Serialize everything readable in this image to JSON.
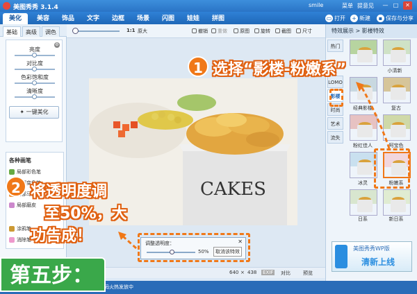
{
  "app": {
    "title": "美图秀秀 3.1.4",
    "user": "smile",
    "menu_link": "菜单",
    "feedback": "提意见",
    "min": "—",
    "max": "□",
    "close": "✕"
  },
  "tabs": [
    "美化",
    "美容",
    "饰品",
    "文字",
    "边框",
    "场景",
    "闪图",
    "娃娃",
    "拼图"
  ],
  "actions": {
    "open": "打开",
    "new": "新建",
    "save": "保存与分享"
  },
  "left_tabs": [
    "基础",
    "高级",
    "调色"
  ],
  "adjust": {
    "labels": [
      "亮度",
      "对比度",
      "色彩饱和度",
      "清晰度"
    ],
    "one_click": "一键美化"
  },
  "brushes": {
    "title": "各种画笔",
    "items": [
      "局部彩色笔",
      "局部变色笔",
      "局部马赛克",
      "局部磨皮",
      "涂鸦笔",
      "消除笔"
    ]
  },
  "toolbar": {
    "ratio": "1:1",
    "orig": "原大",
    "undo": "撤销",
    "redo": "重做",
    "original": "原图",
    "rotate": "旋转",
    "crop": "截图",
    "size": "尺寸"
  },
  "photo": {
    "text": "CAKES"
  },
  "opacity_dialog": {
    "title": "调整透明度：",
    "value": "50%",
    "cancel": "取消该特效",
    "close": "✕"
  },
  "status": {
    "width": "640",
    "x": "×",
    "height": "438",
    "exif": "EXIF",
    "compare": "对比",
    "preview": "预览"
  },
  "right_panel": {
    "header": "特效展示 > 影楼特效",
    "categories": [
      "热门",
      "LOMO",
      "影楼",
      "时尚",
      "艺术",
      "流失"
    ],
    "effects": [
      "小清新",
      "经典影楼",
      "复古",
      "粉红佳人",
      "阿宝色",
      "冰灵",
      "粉嫩系",
      "日系",
      "新日系"
    ],
    "ad_title": "美图秀秀WP版",
    "ad_subtitle": "清新上线"
  },
  "bottom": {
    "text": "码火热发放中"
  },
  "annotations": {
    "badge1": "1",
    "ann1": "选择“影楼-粉嫩系”",
    "badge2": "2",
    "ann2_line1": "将透明度调",
    "ann2_line2": "至50%，大",
    "ann2_line3": "功告成！",
    "step": "第五步："
  }
}
